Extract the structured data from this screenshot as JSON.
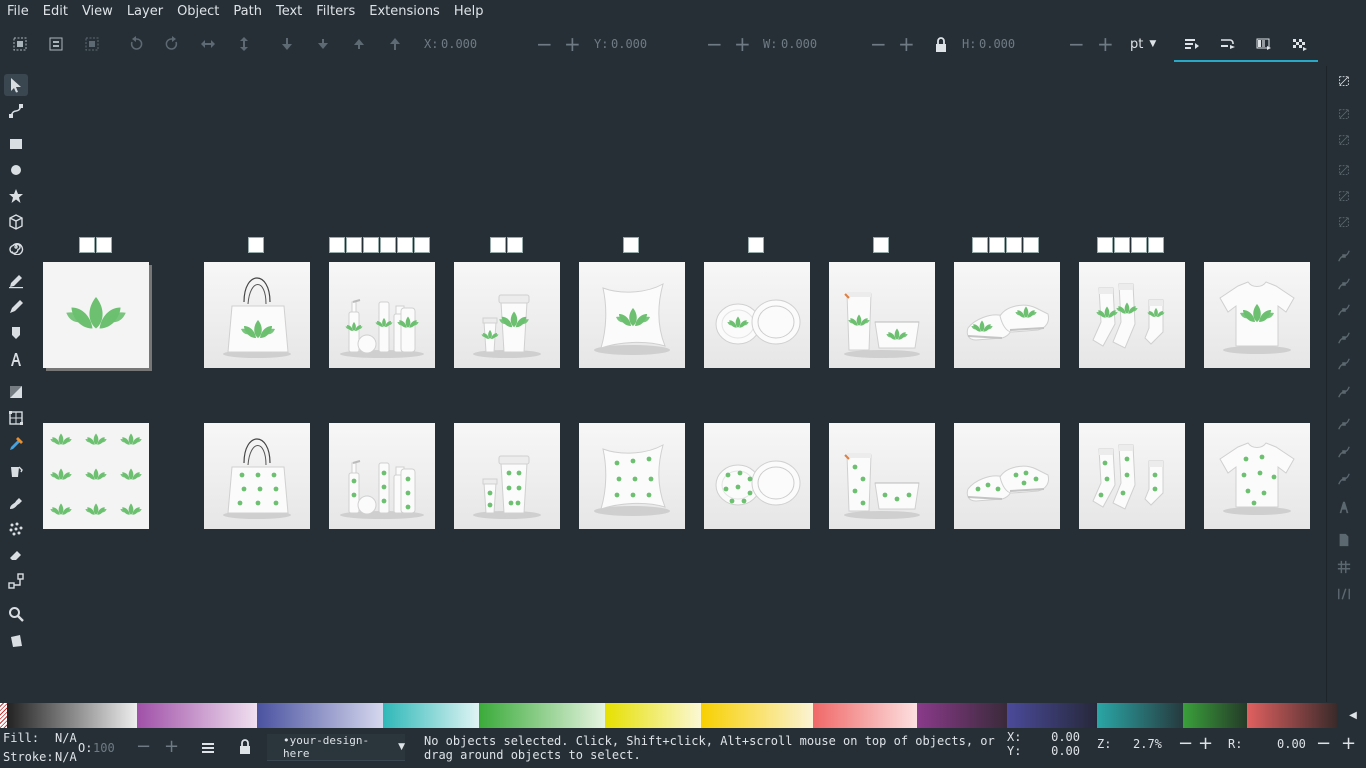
{
  "menu": [
    "File",
    "Edit",
    "View",
    "Layer",
    "Object",
    "Path",
    "Text",
    "Filters",
    "Extensions",
    "Help"
  ],
  "toolbar": {
    "x_label": "X:",
    "x_value": "0.000",
    "y_label": "Y:",
    "y_value": "0.000",
    "w_label": "W:",
    "w_value": "0.000",
    "h_label": "H:",
    "h_value": "0.000",
    "unit": "pt"
  },
  "tools": [
    "selector-tool",
    "node-tool",
    "rectangle-tool",
    "ellipse-tool",
    "star-tool",
    "box3d-tool",
    "spiral-tool",
    "pencil-tool",
    "pen-tool",
    "calligraphy-tool",
    "text-tool",
    "gradient-tool",
    "mesh-tool",
    "dropper-tool",
    "paint-bucket-tool",
    "tweak-tool",
    "spray-tool",
    "eraser-tool",
    "connector-tool",
    "zoom-tool",
    "measure-tool"
  ],
  "canvas": {
    "rows": [
      {
        "variant": "single-logo",
        "items": [
          "design",
          "tote-bag",
          "cosmetics",
          "coffee-cups",
          "pillow",
          "plates",
          "pouch",
          "shoes",
          "socks",
          "tshirt"
        ]
      },
      {
        "variant": "pattern",
        "items": [
          "design",
          "tote-bag",
          "cosmetics",
          "coffee-cups",
          "pillow",
          "plates",
          "pouch",
          "shoes",
          "socks",
          "tshirt"
        ]
      }
    ],
    "page_tab_counts": [
      2,
      0,
      1,
      6,
      2,
      1,
      1,
      1,
      4,
      4
    ]
  },
  "accent_color": "#6cc070",
  "palette": [
    {
      "from": "#222222",
      "to": "#eeeeee"
    },
    {
      "from": "#a050a8",
      "to": "#f0e0f0"
    },
    {
      "from": "#4a52a0",
      "to": "#d6d8ee"
    },
    {
      "from": "#2fb8b8",
      "to": "#e0f4f4"
    },
    {
      "from": "#3aaa3a",
      "to": "#e6f4e0"
    },
    {
      "from": "#e6e000",
      "to": "#fbf8d4"
    },
    {
      "from": "#f8d000",
      "to": "#fbf3d4"
    },
    {
      "from": "#f06868",
      "to": "#fde0e0"
    },
    {
      "from": "#8a3a8a",
      "to": "#3a2a3a"
    },
    {
      "from": "#4a4a9a",
      "to": "#26283a"
    },
    {
      "from": "#2aa6a6",
      "to": "#263a3e"
    },
    {
      "from": "#3aa03a",
      "to": "#243a28"
    },
    {
      "from": "#e06060",
      "to": "#3a2a2a"
    }
  ],
  "status": {
    "fill_label": "Fill:",
    "fill_value": "N/A",
    "stroke_label": "Stroke:",
    "stroke_value": "N/A",
    "opacity_label": "O:",
    "opacity_value": "100",
    "layer_name": "•your-design-here",
    "message": "No objects selected. Click, Shift+click, Alt+scroll mouse on top of objects, or drag around objects to select.",
    "x_label": "X:",
    "x_value": "0.00",
    "y_label": "Y:",
    "y_value": "0.00",
    "zoom_label": "Z:",
    "zoom_value": "2.7%",
    "rotate_label": "R:",
    "rotate_value": "0.00"
  }
}
